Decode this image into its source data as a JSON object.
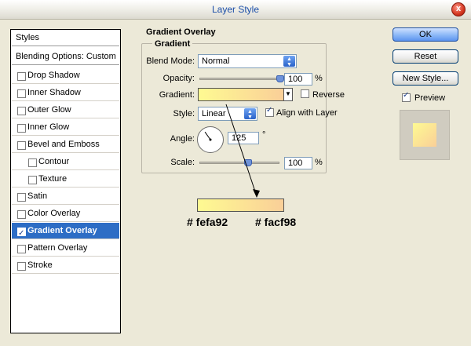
{
  "window": {
    "title": "Layer Style",
    "close_glyph": "x"
  },
  "styles_panel": {
    "header": "Styles",
    "blending": "Blending Options: Custom",
    "items": [
      {
        "label": "Drop Shadow",
        "checked": false,
        "indent": false
      },
      {
        "label": "Inner Shadow",
        "checked": false,
        "indent": false
      },
      {
        "label": "Outer Glow",
        "checked": false,
        "indent": false
      },
      {
        "label": "Inner Glow",
        "checked": false,
        "indent": false
      },
      {
        "label": "Bevel and Emboss",
        "checked": false,
        "indent": false
      },
      {
        "label": "Contour",
        "checked": false,
        "indent": true
      },
      {
        "label": "Texture",
        "checked": false,
        "indent": true
      },
      {
        "label": "Satin",
        "checked": false,
        "indent": false
      },
      {
        "label": "Color Overlay",
        "checked": false,
        "indent": false
      },
      {
        "label": "Gradient Overlay",
        "checked": true,
        "indent": false,
        "selected": true
      },
      {
        "label": "Pattern Overlay",
        "checked": false,
        "indent": false
      },
      {
        "label": "Stroke",
        "checked": false,
        "indent": false
      }
    ]
  },
  "gradient_overlay": {
    "section_title": "Gradient Overlay",
    "group_title": "Gradient",
    "blend_mode": {
      "label": "Blend Mode:",
      "value": "Normal"
    },
    "opacity": {
      "label": "Opacity:",
      "value": "100",
      "unit": "%",
      "level": 1.0
    },
    "gradient": {
      "label": "Gradient:",
      "reverse_label": "Reverse",
      "reverse_checked": false
    },
    "style": {
      "label": "Style:",
      "value": "Linear",
      "align_label": "Align with Layer",
      "align_checked": true
    },
    "angle": {
      "label": "Angle:",
      "value": "125",
      "unit": "°",
      "degrees": 125
    },
    "scale": {
      "label": "Scale:",
      "value": "100",
      "unit": "%",
      "level": 0.6
    }
  },
  "annotation": {
    "left_color_label": "# fefa92",
    "right_color_label": "# facf98"
  },
  "colors": {
    "gradient_start": "#fefa92",
    "gradient_end": "#facf98",
    "selection": "#2d6dc5"
  },
  "buttons": {
    "ok": "OK",
    "reset": "Reset",
    "new_style": "New Style...",
    "preview_label": "Preview",
    "preview_checked": true
  }
}
